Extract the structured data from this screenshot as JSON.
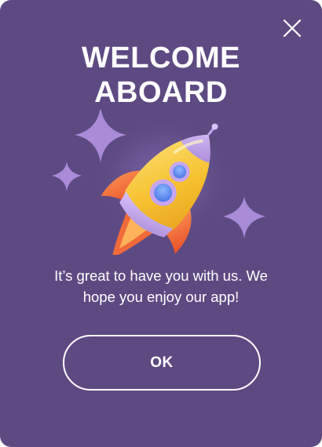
{
  "dialog": {
    "title_line1": "WELCOME",
    "title_line2": "ABOARD",
    "message_line1": "It’s great to have you with us. We",
    "message_line2": "hope you enjoy our app!",
    "ok_label": "OK"
  },
  "icons": {
    "close": "close-icon",
    "illustration": "rocket-icon",
    "decoration": "sparkle-icon"
  },
  "colors": {
    "background": "#5e4a82",
    "text": "#ffffff",
    "sparkle": "#a98bd8",
    "rocket_body": "#f7c83a",
    "rocket_accent": "#c6a6f0",
    "rocket_flame": "#f0683a"
  }
}
